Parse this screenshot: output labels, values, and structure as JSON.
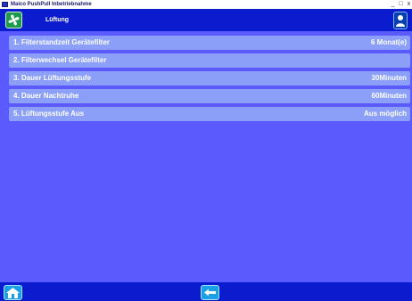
{
  "window": {
    "title": "Maico PushPull Inbetriebnahme",
    "minimize_icon": "_",
    "maximize_icon": "□",
    "close_icon": "x"
  },
  "header": {
    "title": "Lüftung",
    "left_icon": "fan-icon",
    "right_icon": "user-icon"
  },
  "rows": [
    {
      "label": "1. Filterstandzeit Gerätefilter",
      "value": "6 Monat(e)"
    },
    {
      "label": "2. Filterwechsel Gerätefilter",
      "value": ""
    },
    {
      "label": "3. Dauer Lüftungsstufe",
      "value": "30Minuten"
    },
    {
      "label": "4. Dauer Nachtruhe",
      "value": "60Minuten"
    },
    {
      "label": "5. Lüftungsstufe Aus",
      "value": "Aus möglich"
    }
  ],
  "footer": {
    "left_icon": "home-icon",
    "center_icon": "back-arrow-icon"
  },
  "colors": {
    "header": "#0b1ccf",
    "content": "#5b5bfd",
    "row": "#8b9ff8",
    "fan_button": "#1e9a4c",
    "footer_button": "#1aa0e6"
  }
}
